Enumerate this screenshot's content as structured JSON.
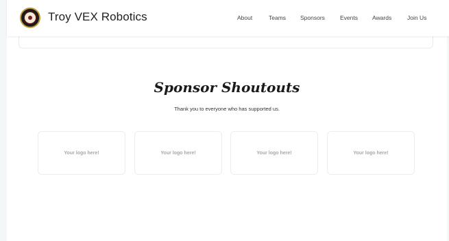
{
  "header": {
    "title": "Troy VEX Robotics",
    "logo_icon": "robotics-seal-logo",
    "nav": [
      "About",
      "Teams",
      "Sponsors",
      "Events",
      "Awards",
      "Join Us"
    ]
  },
  "sponsors": {
    "heading": "Sponsor Shoutouts",
    "subtext": "Thank you to everyone who has supported us.",
    "cards": [
      "Your logo here!",
      "Your logo here!",
      "Your logo here!",
      "Your logo here!"
    ]
  },
  "colors": {
    "background": "#f4f7f8",
    "logo_ring": "#c49a3a",
    "logo_accent": "#7a1f1f"
  }
}
